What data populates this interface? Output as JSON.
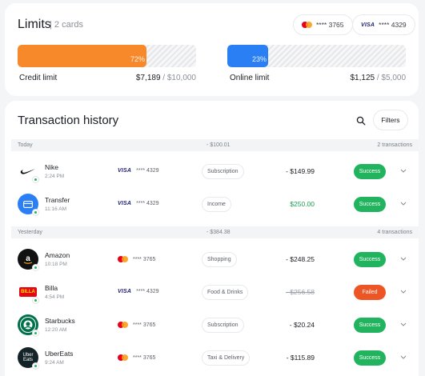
{
  "limits": {
    "title": "Limits",
    "subtitle": "| 2 cards",
    "cards": [
      {
        "brand": "mastercard",
        "number": "**** 3765"
      },
      {
        "brand": "visa",
        "brand_text": "VISA",
        "number": "**** 4329"
      }
    ],
    "credit": {
      "label": "Credit limit",
      "percent": 72,
      "percent_text": "72%",
      "used": "$7,189",
      "total": " / $10,000",
      "color": "#f7892b"
    },
    "online": {
      "label": "Online limit",
      "percent": 23,
      "percent_text": "23%",
      "used": "$1,125",
      "total": " / $5,000",
      "color": "#2b7ff5"
    }
  },
  "transactions": {
    "title": "Transaction history",
    "search_icon": "search-icon",
    "filters_label": "Filters",
    "groups": [
      {
        "day": "Today",
        "total": "- $100.01",
        "count": "2 transactions"
      },
      {
        "day": "Yesterday",
        "total": "- $384.38",
        "count": "4 transactions"
      }
    ],
    "rows": [
      {
        "merchant": "Nike",
        "time": "2:24 PM",
        "card_brand": "VISA",
        "card": "**** 4329",
        "category": "Subscription",
        "amount": "- $149.99",
        "status": "Success"
      },
      {
        "merchant": "Transfer",
        "time": "11:16 AM",
        "card_brand": "VISA",
        "card": "**** 4329",
        "category": "Income",
        "amount": "$250.00",
        "status": "Success"
      },
      {
        "merchant": "Amazon",
        "time": "10:18 PM",
        "card_brand": "mastercard",
        "card": "**** 3765",
        "category": "Shopping",
        "amount": "- $248.25",
        "status": "Success"
      },
      {
        "merchant": "Billa",
        "time": "4:54 PM",
        "card_brand": "VISA",
        "card": "**** 4329",
        "category": "Food & Drinks",
        "amount": "- $256.58",
        "status": "Failed",
        "avatar_text": "BILLA"
      },
      {
        "merchant": "Starbucks",
        "time": "12:20 AM",
        "card_brand": "mastercard",
        "card": "**** 3765",
        "category": "Subscription",
        "amount": "- $20.24",
        "status": "Success"
      },
      {
        "merchant": "UberEats",
        "time": "9:24 AM",
        "card_brand": "mastercard",
        "card": "**** 3765",
        "category": "Taxi & Delivery",
        "amount": "- $115.89",
        "status": "Success",
        "avatar_text": "Uber Eats"
      }
    ]
  },
  "colors": {
    "success": "#22b35e",
    "failed": "#ee5525",
    "income": "#1f9d55"
  }
}
